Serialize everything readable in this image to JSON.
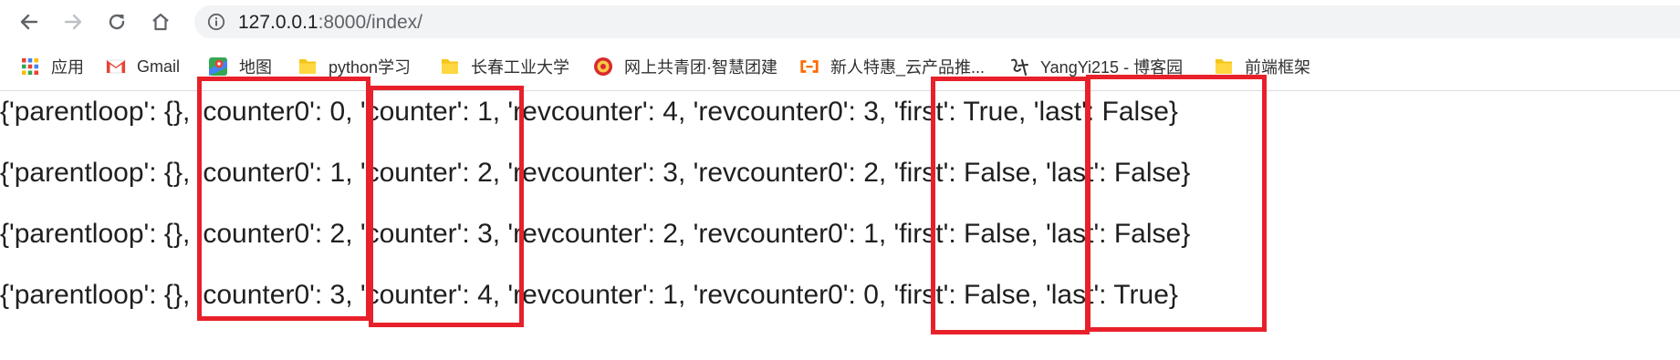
{
  "browser": {
    "url_host": "127.0.0.1",
    "url_rest": ":8000/index/"
  },
  "bookmarks": [
    {
      "label": "应用",
      "icon": "apps-grid-icon"
    },
    {
      "label": "Gmail",
      "icon": "gmail-icon"
    },
    {
      "label": "地图",
      "icon": "maps-icon"
    },
    {
      "label": "python学习",
      "icon": "folder-icon"
    },
    {
      "label": "长春工业大学",
      "icon": "folder-icon"
    },
    {
      "label": "网上共青团·智慧团建",
      "icon": "league-emblem-icon"
    },
    {
      "label": "新人特惠_云产品推...",
      "icon": "aliyun-icon"
    },
    {
      "label": "YangYi215 - 博客园",
      "icon": "cnblogs-icon"
    },
    {
      "label": "前端框架",
      "icon": "folder-icon"
    }
  ],
  "loop_lines": [
    {
      "parentloop": "{'parentloop': {},",
      "counter0": " 'counter0': 0,",
      "counter": " 'counter': 1,",
      "revcounter": " 'revcounter': 4, 'revcounter0': 3,",
      "first": " 'first': True,",
      "last": " 'last': False}"
    },
    {
      "parentloop": "{'parentloop': {},",
      "counter0": " 'counter0': 1,",
      "counter": " 'counter': 2,",
      "revcounter": " 'revcounter': 3, 'revcounter0': 2,",
      "first": " 'first': False,",
      "last": " 'last': False}"
    },
    {
      "parentloop": "{'parentloop': {},",
      "counter0": " 'counter0': 2,",
      "counter": " 'counter': 3,",
      "revcounter": " 'revcounter': 2, 'revcounter0': 1,",
      "first": " 'first': False,",
      "last": " 'last': False}"
    },
    {
      "parentloop": "{'parentloop': {},",
      "counter0": " 'counter0': 3,",
      "counter": " 'counter': 4,",
      "revcounter": " 'revcounter': 1, 'revcounter0': 0,",
      "first": " 'first': False,",
      "last": " 'last': True}"
    }
  ],
  "highlight_color": "#e8202a"
}
